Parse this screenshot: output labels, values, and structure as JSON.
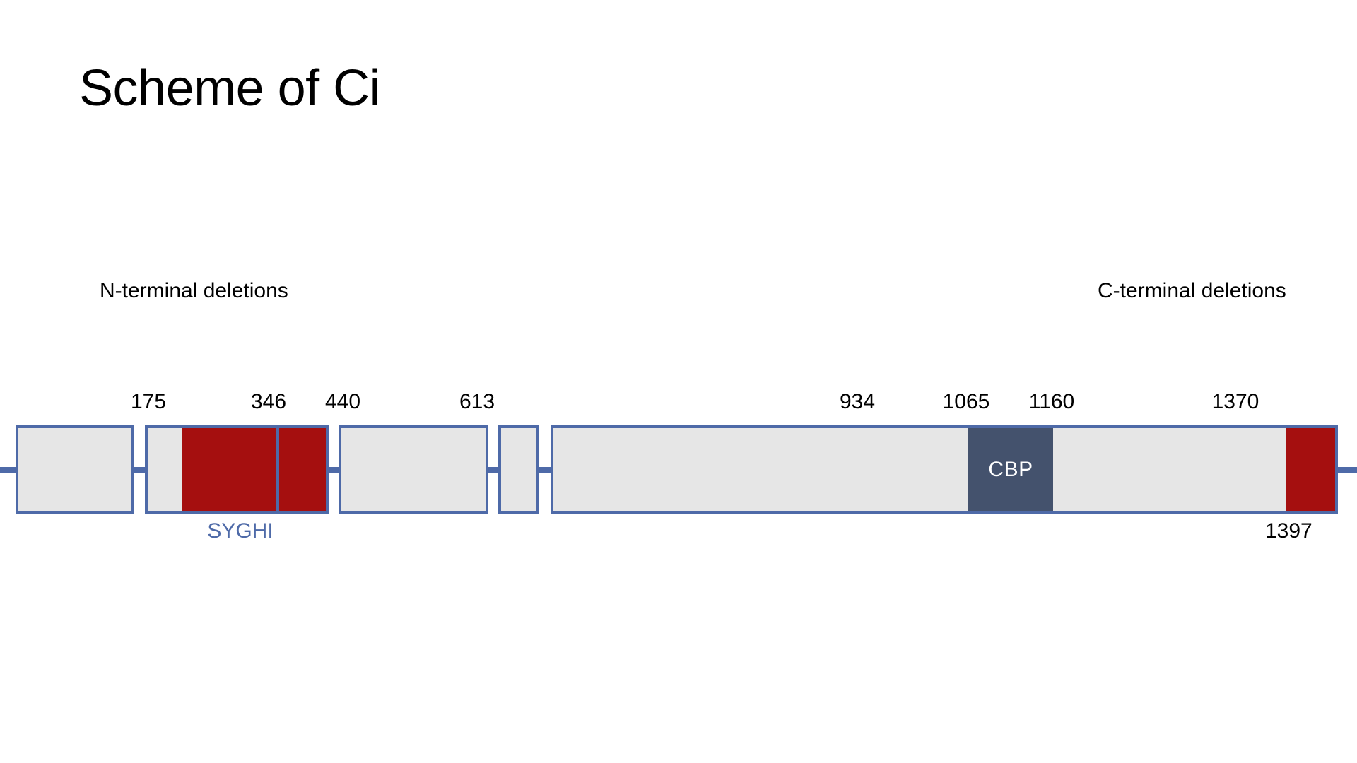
{
  "slide": {
    "title": "Scheme of Ci",
    "background_color": "#ffffff"
  },
  "colors": {
    "outline_blue": "#4e6aa8",
    "box_gray": "#e6e6e6",
    "deletion_red": "#a50f0f",
    "cbp_slate": "#44526d",
    "motif_blue": "#4e6aa8",
    "text_black": "#000000"
  },
  "diagram": {
    "group_labels": {
      "n_terminal": "N-terminal deletions",
      "c_terminal": "C-terminal deletions"
    },
    "tick_labels": [
      {
        "value": "175"
      },
      {
        "value": "346"
      },
      {
        "value": "440"
      },
      {
        "value": "613"
      },
      {
        "value": "934"
      },
      {
        "value": "1065"
      },
      {
        "value": "1160"
      },
      {
        "value": "1370"
      }
    ],
    "end_label": "1397",
    "motif": {
      "name": "SYGHI"
    },
    "domains": [
      {
        "name": "CBP",
        "start": "1065",
        "end": "1160",
        "color": "#44526d"
      }
    ],
    "segments": [
      {
        "id": "seg-1",
        "fill": "gray",
        "label": ""
      },
      {
        "id": "seg-2",
        "fill": "mixed",
        "label": ""
      },
      {
        "id": "seg-3",
        "fill": "gray",
        "label": ""
      },
      {
        "id": "seg-4",
        "fill": "gray",
        "label": ""
      },
      {
        "id": "seg-5",
        "fill": "mixed",
        "label": ""
      }
    ]
  },
  "chart_data": {
    "type": "diagram",
    "title": "Scheme of Ci",
    "protein_length": 1397,
    "xlabel": "",
    "ylabel": "",
    "annotations": [
      "N-terminal deletions",
      "C-terminal deletions",
      "SYGHI",
      "CBP",
      "1397"
    ],
    "tick_values": [
      175,
      346,
      440,
      613,
      934,
      1065,
      1160,
      1370
    ],
    "features": [
      {
        "name": "SYGHI motif region",
        "color": "#a50f0f",
        "approx_start": 175,
        "approx_end": 346
      },
      {
        "name": "CBP binding domain",
        "color": "#44526d",
        "approx_start": 1065,
        "approx_end": 1160
      },
      {
        "name": "C-terminal deletion region",
        "color": "#a50f0f",
        "approx_start": 1370,
        "approx_end": 1397
      }
    ]
  }
}
